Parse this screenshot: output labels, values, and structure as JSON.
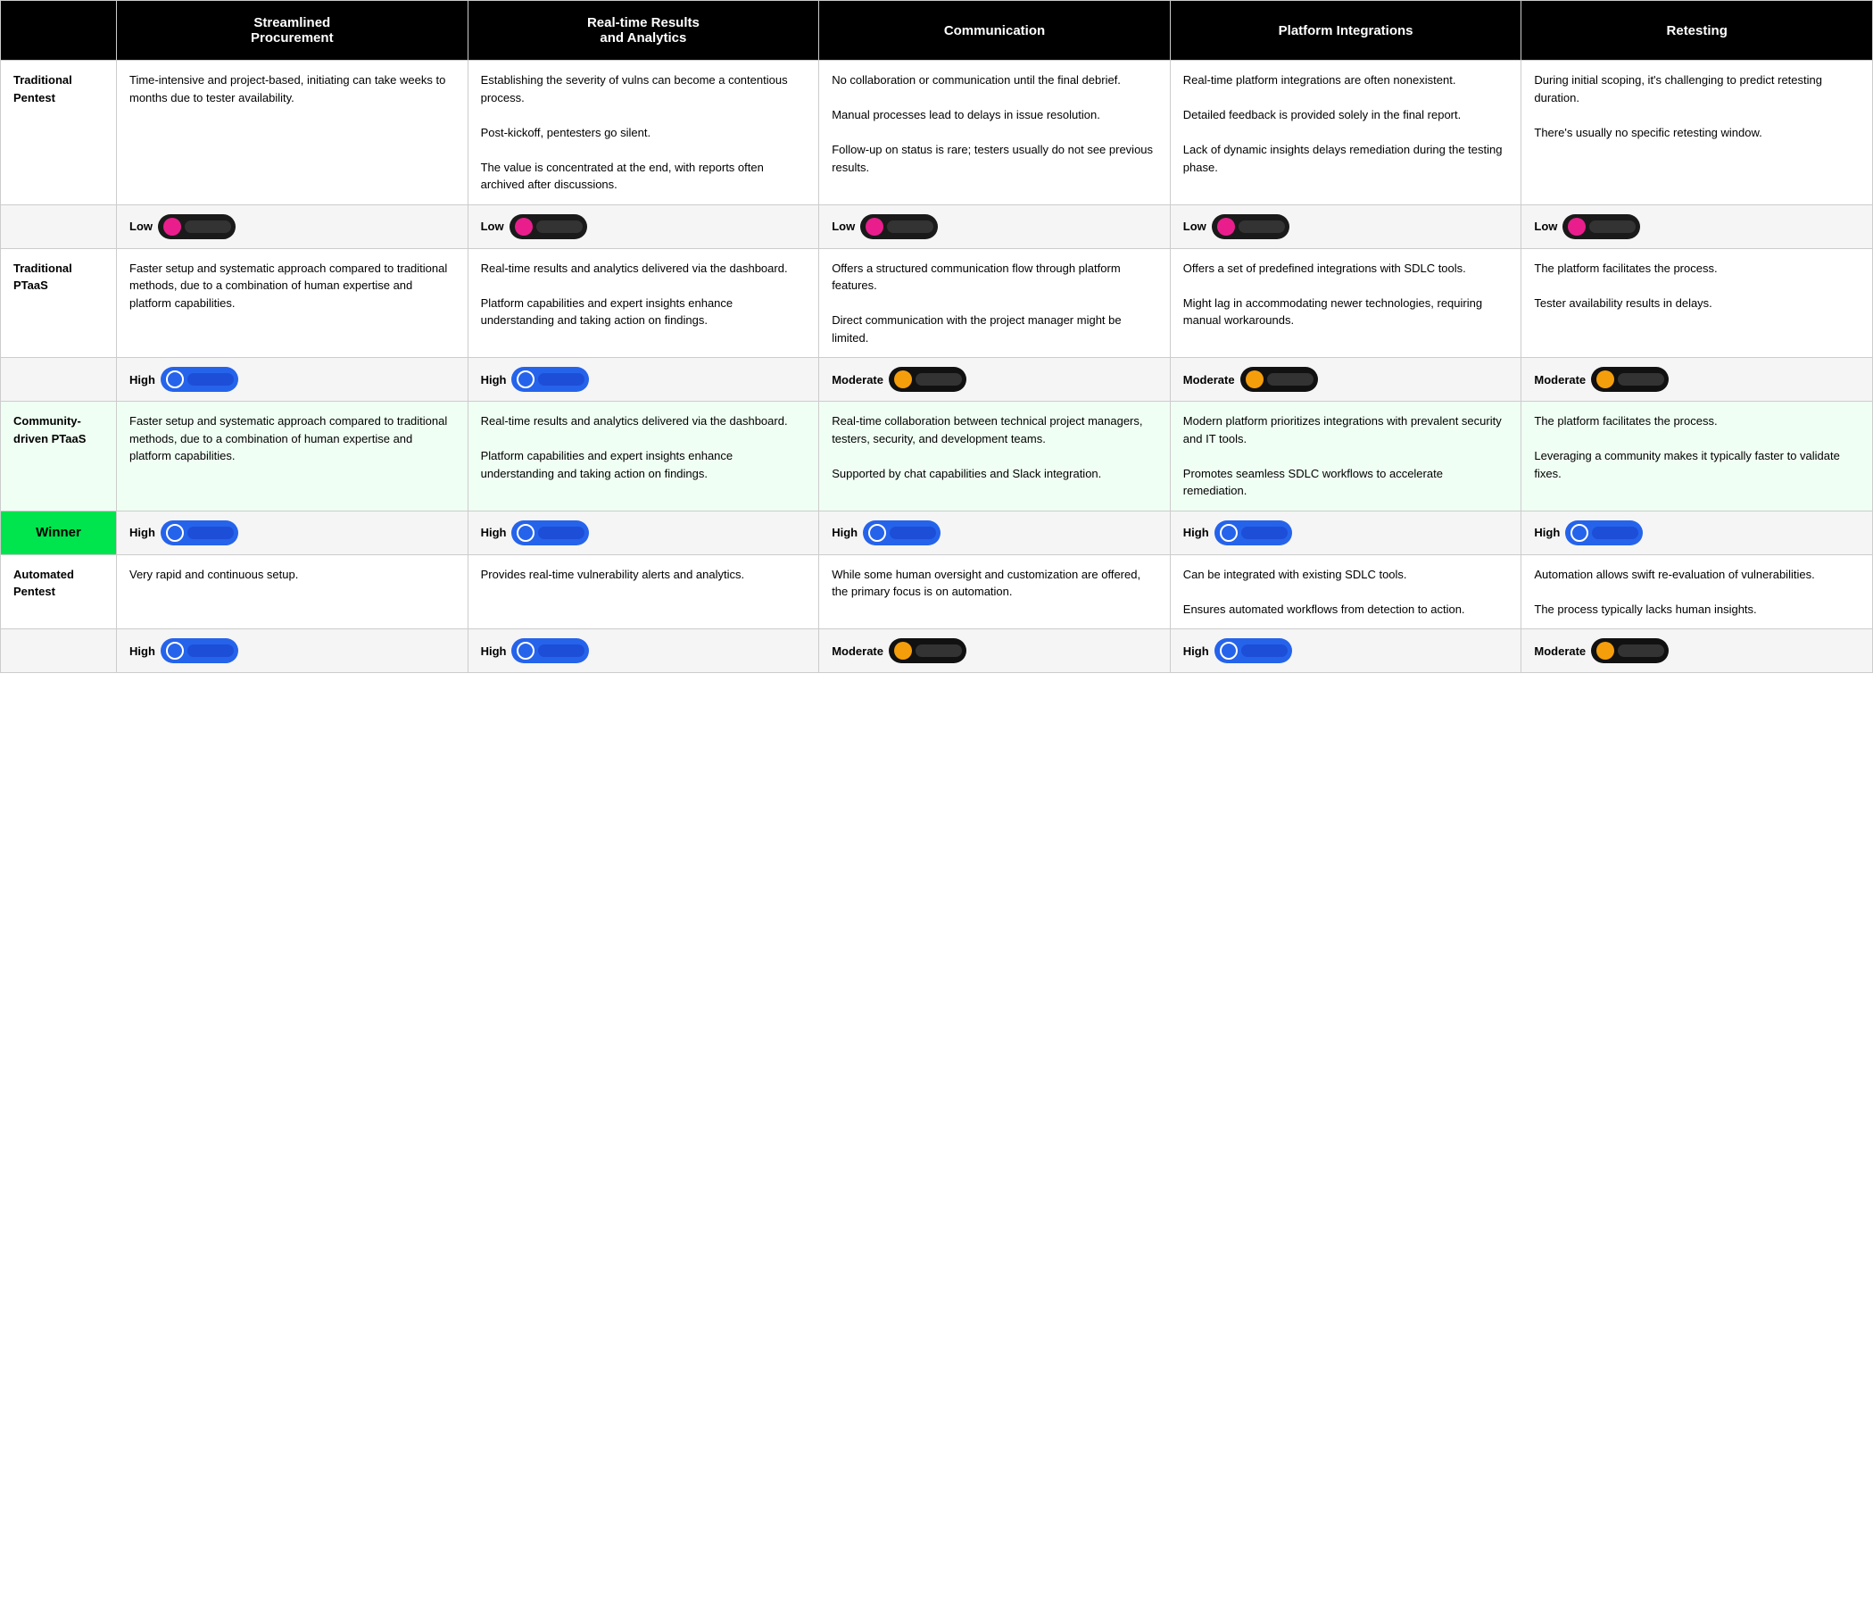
{
  "table": {
    "headers": [
      "",
      "Streamlined Procurement",
      "Real-time Results and Analytics",
      "Communication",
      "Platform Integrations",
      "Retesting"
    ],
    "rows": [
      {
        "id": "traditional-pentest",
        "label": "Traditional\nPentest",
        "cells": [
          "Time-intensive and project-based, initiating can take weeks to months due to tester availability.",
          "Establishing the severity of vulns can become a contentious process.\n\nPost-kickoff, pentesters go silent.\n\nThe value is concentrated at the end, with reports often archived after discussions.",
          "No collaboration or communication until the final debrief.\n\nManual processes lead to delays in issue resolution.\n\nFollow-up on status is rare; testers usually do not see previous results.",
          "Real-time platform integrations are often nonexistent.\n\nDetailed feedback is provided solely in the final report.\n\nLack of dynamic insights delays remediation during the testing phase.",
          "During initial scoping, it's challenging to predict retesting duration.\n\nThere's usually no specific retesting window."
        ],
        "rating": {
          "label": "Low",
          "circleColor": "#e91e8c",
          "barColor": "#1a1a1a",
          "type": "low-pink"
        }
      },
      {
        "id": "traditional-ptaas",
        "label": "Traditional\nPTaaS",
        "cells": [
          "Faster setup and systematic approach compared to traditional methods, due to a combination of human expertise and platform capabilities.",
          "Real-time results and analytics delivered via the dashboard.\n\nPlatform capabilities and expert insights enhance understanding and taking action on findings.",
          "Offers a structured communication flow through platform features.\n\nDirect communication with the project manager might be limited.",
          "Offers a set of predefined integrations with SDLC tools.\n\nMight lag in accommodating newer technologies, requiring manual workarounds.",
          "The platform facilitates the process.\n\nTester availability results in delays."
        ],
        "rating": {
          "label": "High",
          "circleColor": "#2563eb",
          "barColor": "#2563eb",
          "type": "high-blue"
        }
      },
      {
        "id": "community-ptaas",
        "label": "Community-driven PTaaS",
        "cells": [
          "Faster setup and systematic approach compared to traditional methods, due to a combination of human expertise and platform capabilities.",
          "Real-time results and analytics delivered via the dashboard.\n\nPlatform capabilities and expert insights enhance understanding and taking action on findings.",
          "Real-time collaboration between technical project managers, testers, security, and development teams.\n\nSupported by chat capabilities and Slack integration.",
          "Modern platform prioritizes integrations with prevalent security and IT tools.\n\nPromotes seamless SDLC workflows to accelerate remediation.",
          "The platform facilitates the process.\n\nLeveraging a community makes it typically faster to validate fixes."
        ],
        "rating": {
          "label": "High",
          "circleColor": "#2563eb",
          "barColor": "#2563eb",
          "type": "high-blue",
          "winner": true
        }
      },
      {
        "id": "automated-pentest",
        "label": "Automated\nPentest",
        "cells": [
          "Very rapid and continuous setup.",
          "Provides real-time vulnerability alerts and analytics.",
          "While some human oversight and customization are offered, the primary focus is on automation.",
          "Can be integrated with existing SDLC tools.\n\nEnsures automated workflows from detection to action.",
          "Automation allows swift re-evaluation of vulnerabilities.\n\nThe process typically lacks human insights."
        ],
        "rating": {
          "label_procurement": "High",
          "label_analytics": "High",
          "label_communication": "Moderate",
          "label_platform": "High",
          "label_retesting": "Moderate",
          "ratings": [
            {
              "label": "High",
              "type": "high-blue"
            },
            {
              "label": "High",
              "type": "high-blue"
            },
            {
              "label": "Moderate",
              "type": "moderate-yellow"
            },
            {
              "label": "High",
              "type": "high-blue"
            },
            {
              "label": "Moderate",
              "type": "moderate-yellow"
            }
          ]
        }
      }
    ],
    "winner_ratings": [
      {
        "label": "High",
        "type": "high-blue"
      },
      {
        "label": "High",
        "type": "high-blue"
      },
      {
        "label": "High",
        "type": "high-blue"
      },
      {
        "label": "High",
        "type": "high-blue"
      },
      {
        "label": "High",
        "type": "high-blue"
      }
    ],
    "traditional_pentest_ratings": [
      {
        "label": "Low",
        "type": "low-pink"
      },
      {
        "label": "Low",
        "type": "low-pink"
      },
      {
        "label": "Low",
        "type": "low-pink"
      },
      {
        "label": "Low",
        "type": "low-pink"
      },
      {
        "label": "Low",
        "type": "low-pink"
      }
    ],
    "traditional_ptaas_ratings": [
      {
        "label": "High",
        "type": "high-blue"
      },
      {
        "label": "High",
        "type": "high-blue"
      },
      {
        "label": "Moderate",
        "type": "moderate-yellow"
      },
      {
        "label": "Moderate",
        "type": "moderate-yellow"
      },
      {
        "label": "Moderate",
        "type": "moderate-yellow"
      }
    ]
  }
}
